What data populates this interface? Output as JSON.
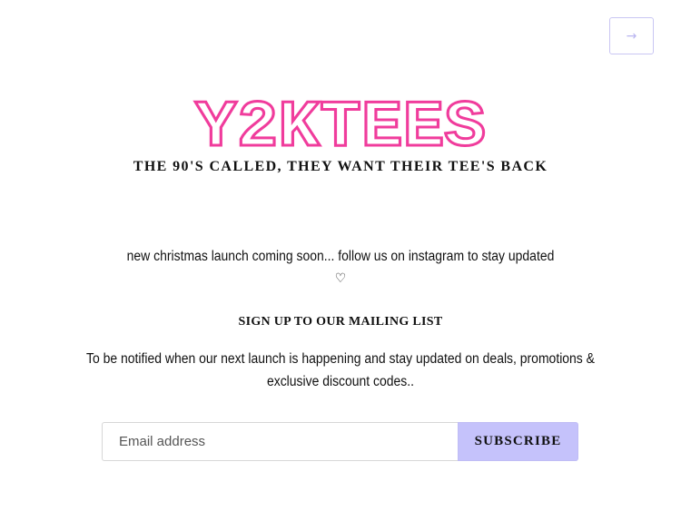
{
  "header": {
    "enter_icon": "arrow-right-icon",
    "enter_glyph": "→"
  },
  "brand": {
    "logo_text": "Y2KTEES",
    "logo_color": "#f03c9c",
    "tagline": "THE 90'S CALLED, THEY WANT THEIR TEE'S BACK"
  },
  "announcement": {
    "text": "new christmas launch coming soon... follow us on instagram to stay updated",
    "heart": "♡"
  },
  "mailing": {
    "title": "SIGN UP TO OUR MAILING LIST",
    "description": "To be notified when our next launch is happening and stay updated on deals, promotions & exclusive discount codes..",
    "email_placeholder": "Email address",
    "subscribe_label": "SUBSCRIBE",
    "accent_color": "#c5c2fb"
  }
}
